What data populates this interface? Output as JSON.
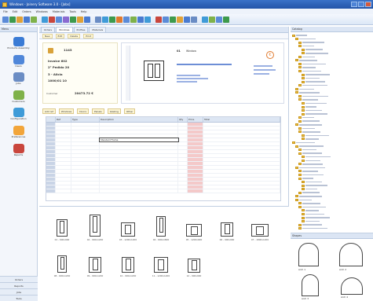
{
  "window": {
    "title": "Windows - Joinery Software 3.0 - [Jobs]"
  },
  "menu": [
    "File",
    "Edit",
    "Orders",
    "Windows",
    "Materials",
    "Tools",
    "Help"
  ],
  "left_nav": {
    "header": "Menu",
    "items": [
      {
        "label": "Products Assembly",
        "icon": "products-icon",
        "color": "#3a7bd5"
      },
      {
        "label": "Users",
        "icon": "users-icon",
        "color": "#4f86d9"
      },
      {
        "label": "Jobs",
        "icon": "jobs-icon",
        "color": "#6a8cc4"
      },
      {
        "label": "Customers",
        "icon": "customers-icon",
        "color": "#7fb24a"
      },
      {
        "label": "Configuration",
        "icon": "configuration-icon",
        "color": "#3f9bd8"
      },
      {
        "label": "Preferences",
        "icon": "preferences-icon",
        "color": "#f2a53a"
      },
      {
        "label": "Reports",
        "icon": "reports-icon",
        "color": "#c9463d"
      }
    ],
    "bottom": [
      "Orders",
      "Reports",
      "Jobs",
      "Tools"
    ]
  },
  "tabs": [
    "Orders",
    "Windows",
    "Profiles",
    "Materials"
  ],
  "subbar": [
    "New",
    "Edit",
    "Delete",
    "Print"
  ],
  "info": {
    "title": "1143",
    "lines": [
      "Invoice 602",
      "2° Pedido 20",
      "3 - Alicia",
      "1000/01 10"
    ],
    "customer_label": "Customer",
    "total": "20473.72 €"
  },
  "preview": {
    "number": "01",
    "label": "Window",
    "price": "€"
  },
  "filters": [
    "Add ref",
    "Windows",
    "Doors",
    "Panels",
    "Glazing",
    "Other"
  ],
  "grid": {
    "columns": [
      "",
      "Ref",
      "Type",
      "Description",
      "Qty",
      "Price",
      "Total"
    ],
    "rows": 18,
    "selected_text": "Standard Frame"
  },
  "thumbs": [
    {
      "label": "01 - 600x900"
    },
    {
      "label": "02 - 900x1200"
    },
    {
      "label": "03 - 1200x1200"
    },
    {
      "label": "04 - 600x1800"
    },
    {
      "label": "05 - 1200x900"
    },
    {
      "label": "06 - 900x900"
    },
    {
      "label": "07 - 1800x1200"
    },
    {
      "label": "08 - 600x1200"
    },
    {
      "label": "09 - 900x1200"
    },
    {
      "label": "10 - 900x1200"
    },
    {
      "label": "11 - 1200x1200"
    },
    {
      "label": "12 - 900x900"
    }
  ],
  "right_panel": {
    "header": "Catalog",
    "tree_count": 55,
    "footer_header": "Shapes",
    "shapes": [
      "Arch 1",
      "Arch 2",
      "Arch 3",
      "Arch 4"
    ]
  }
}
